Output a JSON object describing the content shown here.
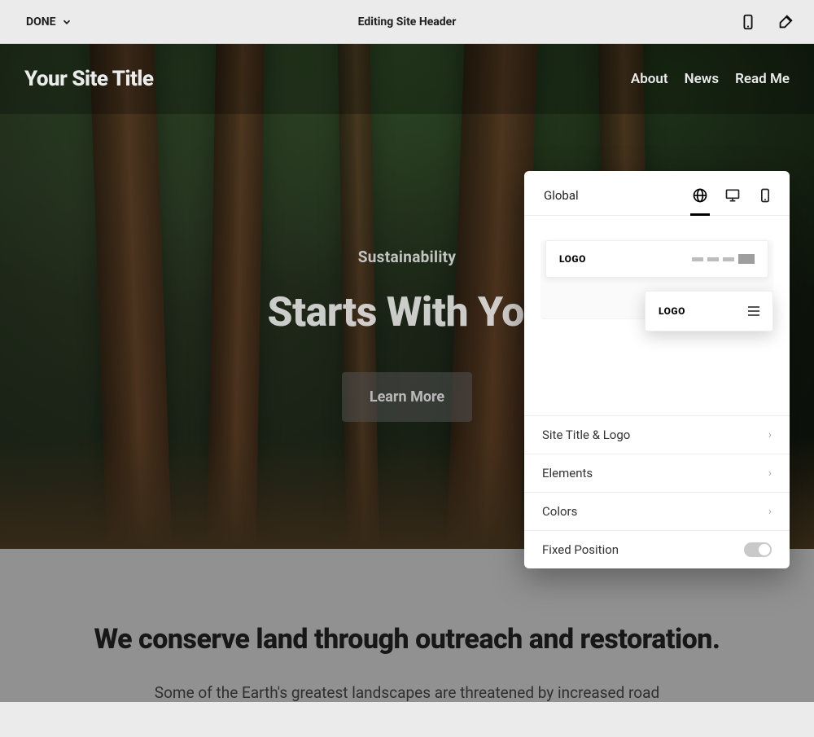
{
  "editor": {
    "done_label": "DONE",
    "title": "Editing Site Header"
  },
  "site": {
    "title": "Your Site Title",
    "nav": [
      "About",
      "News",
      "Read Me"
    ]
  },
  "hero": {
    "eyebrow": "Sustainability",
    "headline": "Starts With You",
    "cta": "Learn More"
  },
  "section": {
    "heading": "We conserve land through outreach and restoration.",
    "body": "Some of the Earth's greatest landscapes are threatened by increased road"
  },
  "panel": {
    "header_title": "Global",
    "layout_a_label": "LOGO",
    "layout_b_label": "LOGO",
    "rows": {
      "site_title_logo": "Site Title & Logo",
      "elements": "Elements",
      "colors": "Colors",
      "fixed_position": "Fixed Position"
    }
  }
}
